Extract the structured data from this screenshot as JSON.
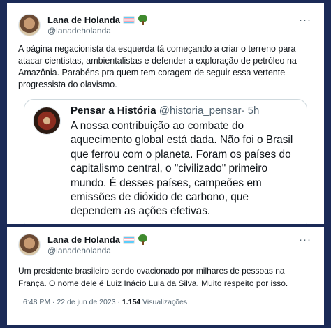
{
  "tweet1": {
    "author_name": "Lana de Holanda",
    "author_handle": "@lanadeholanda",
    "more_label": "···",
    "text": "A página negacionista da esquerda tá começando a criar o terreno para atacar cientistas, ambientalistas e defender a exploração de petróleo na Amazônia. Parabéns pra quem tem coragem de seguir essa vertente progressista do olavismo.",
    "quote": {
      "author_name": "Pensar a História",
      "author_handle": "@historia_pensar",
      "time": "· 5h",
      "text": "A nossa contribuição ao combate do aquecimento global está dada. Não foi o Brasil que ferrou com o planeta. Foram os países do capitalismo central, o \"civilizado\" primeiro mundo. É desses países, campeões em emissões de dióxido de carbono, que dependem as ações efetivas."
    }
  },
  "tweet2": {
    "author_name": "Lana de Holanda",
    "author_handle": "@lanadeholanda",
    "more_label": "···",
    "text": "Um presidente brasileiro sendo ovacionado por milhares de pessoas na França. O nome dele é Luiz Inácio Lula da Silva. Muito respeito por isso.",
    "time": "6:48 PM",
    "date": "22 de jun de 2023",
    "views_count": "1.154",
    "views_label": "Visualizações"
  },
  "icons": {
    "flag": "transgender-flag-icon",
    "tree": "tree-icon",
    "more": "more-options-icon"
  },
  "colors": {
    "background": "#1b2a57",
    "card": "#ffffff",
    "text": "#0f1419",
    "secondary_text": "#536471",
    "border": "#cfd9de"
  }
}
